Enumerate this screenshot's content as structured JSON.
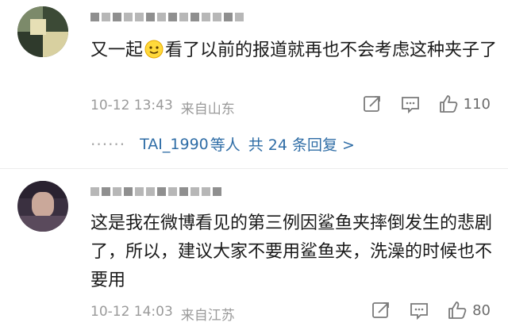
{
  "comments": [
    {
      "text_before_emoji": "又一起",
      "text_after_emoji": "看了以前的报道就再也不会考虑这种夹子了",
      "emoji_icon": "smirk-face-emoji",
      "time": "10-12 13:43",
      "location": "来自山东",
      "like_count": "110",
      "replies": {
        "dots": "······",
        "user": "TAI_1990",
        "suffix": "等人",
        "link": "共 24 条回复 >"
      }
    },
    {
      "text": "这是我在微博看见的第三例因鲨鱼夹摔倒发生的悲剧了，所以，建议大家不要用鲨鱼夹，洗澡的时候也不要用",
      "time": "10-12 14:03",
      "location": "来自江苏",
      "like_count": "80"
    }
  ],
  "colors": {
    "link_blue": "#2f6da6",
    "meta_gray": "#9a9a9a",
    "text": "#1a1a1a"
  }
}
